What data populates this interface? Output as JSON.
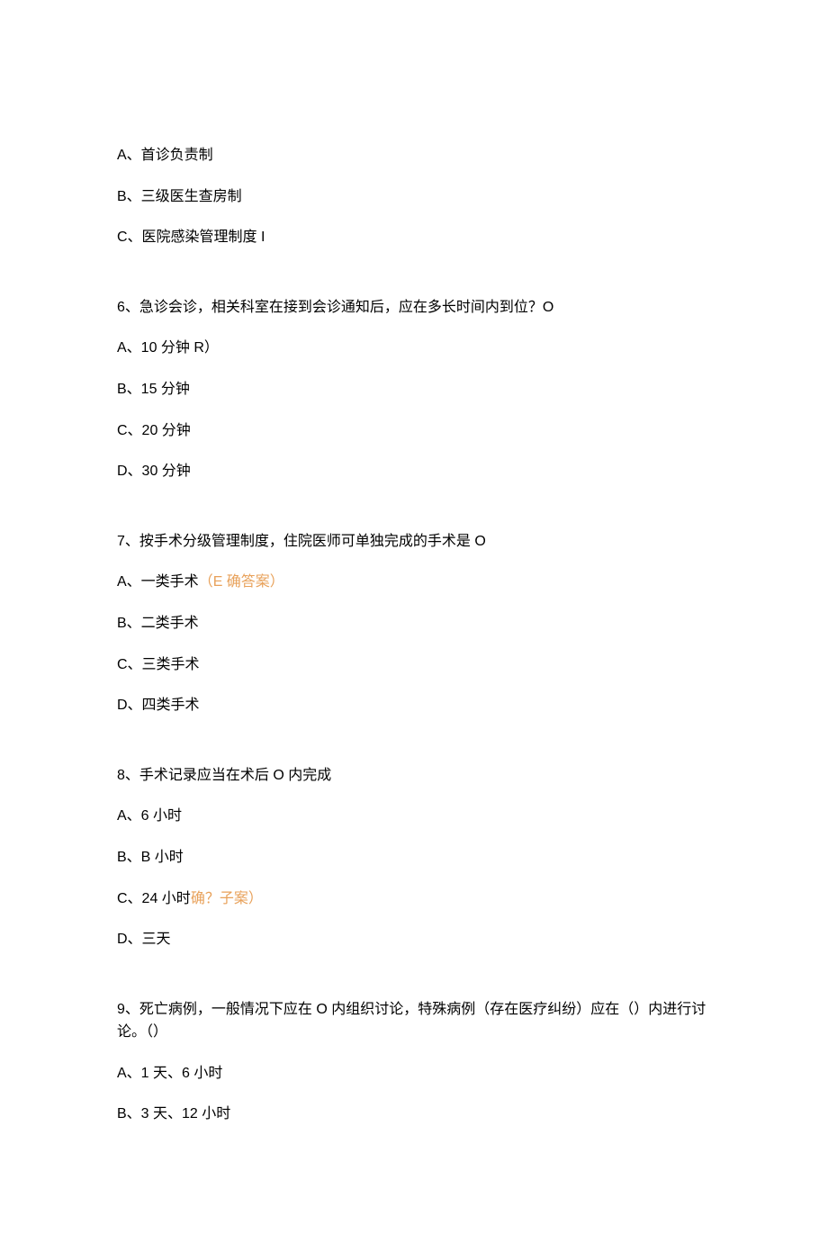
{
  "lines": [
    {
      "text": "A、首诊负责制",
      "note": "",
      "isQuestion": false
    },
    {
      "text": "B、三级医生查房制",
      "note": "",
      "isQuestion": false
    },
    {
      "text": "C、医院感染管理制度 I",
      "note": "",
      "isQuestion": false
    },
    {
      "text": "6、急诊会诊，相关科室在接到会诊通知后，应在多长时间内到位？O",
      "note": "",
      "isQuestion": true
    },
    {
      "text": "A、10 分钟 R）",
      "note": "",
      "isQuestion": false
    },
    {
      "text": "B、15 分钟",
      "note": "",
      "isQuestion": false
    },
    {
      "text": "C、20 分钟",
      "note": "",
      "isQuestion": false
    },
    {
      "text": "D、30 分钟",
      "note": "",
      "isQuestion": false
    },
    {
      "text": "7、按手术分级管理制度，住院医师可单独完成的手术是 O",
      "note": "",
      "isQuestion": true
    },
    {
      "text": "A、一类手术",
      "note": "（E 确答案）",
      "isQuestion": false
    },
    {
      "text": "B、二类手术",
      "note": "",
      "isQuestion": false
    },
    {
      "text": "C、三类手术",
      "note": "",
      "isQuestion": false
    },
    {
      "text": "D、四类手术",
      "note": "",
      "isQuestion": false
    },
    {
      "text": "8、手术记录应当在术后 O 内完成",
      "note": "",
      "isQuestion": true
    },
    {
      "text": "A、6 小时",
      "note": "",
      "isQuestion": false
    },
    {
      "text": "B、B 小时",
      "note": "",
      "isQuestion": false
    },
    {
      "text": "C、24 小时",
      "note": "确？子案）",
      "isQuestion": false
    },
    {
      "text": "D、三天",
      "note": "",
      "isQuestion": false
    },
    {
      "text": "9、死亡病例，一般情况下应在 O 内组织讨论，特殊病例（存在医疗纠纷）应在（）内进行讨论。（）",
      "note": "",
      "isQuestion": true
    },
    {
      "text": "A、1 天、6 小时",
      "note": "",
      "isQuestion": false
    },
    {
      "text": "B、3 天、12 小时",
      "note": "",
      "isQuestion": false
    }
  ]
}
